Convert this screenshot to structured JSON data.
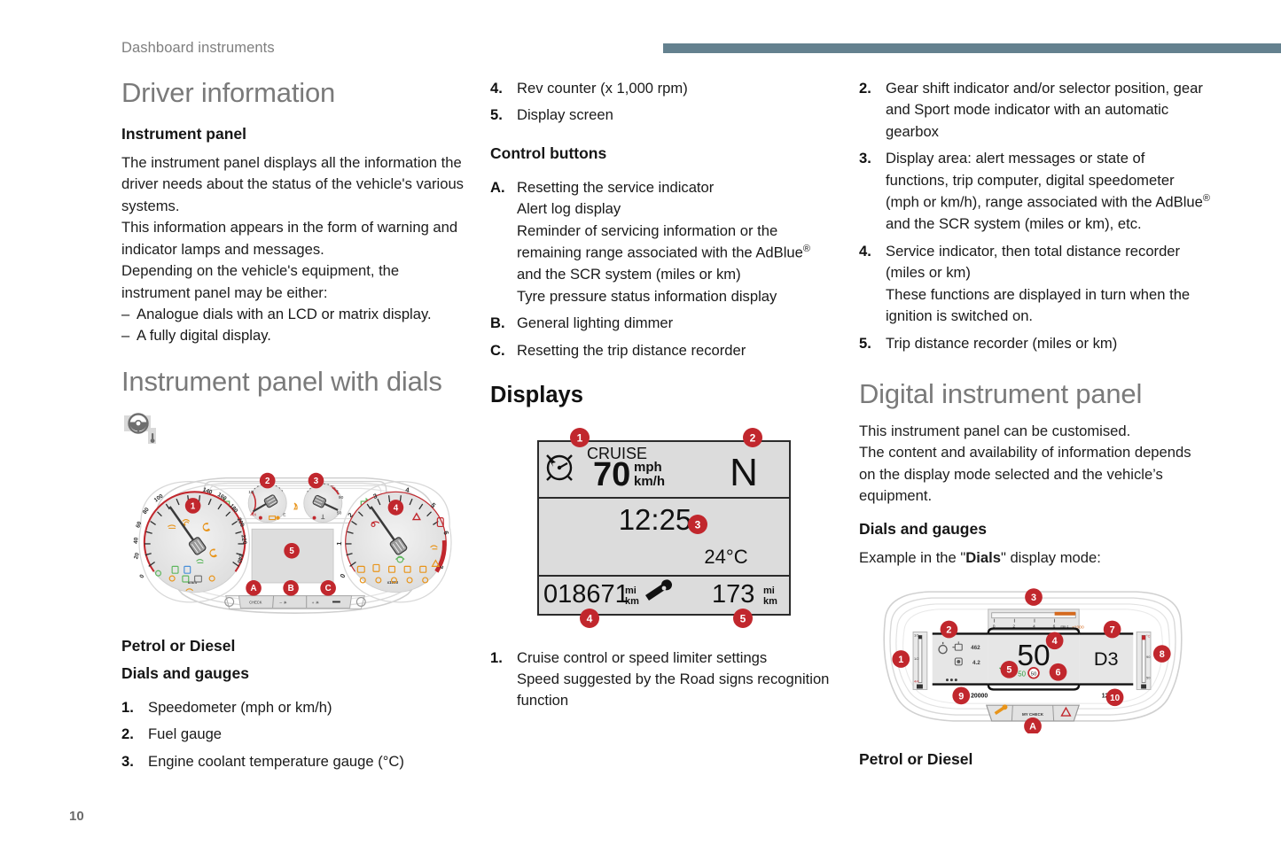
{
  "page": {
    "running_head": "Dashboard instruments",
    "folio": "10",
    "accent_rule_color": "#64818f",
    "callout_color": "#c1272d"
  },
  "col1": {
    "chapter_title": "Driver information",
    "instrument_panel_heading": "Instrument panel",
    "paragraphs": [
      "The instrument panel displays all the information the driver needs about the status of the vehicle's various systems.",
      "This information appears in the form of warning and indicator lamps and messages.",
      "Depending on the vehicle's equipment, the instrument panel may be either:"
    ],
    "bullets": [
      "Analogue dials with an LCD or matrix display.",
      "A fully digital display."
    ],
    "dials_section_title": "Instrument panel with dials",
    "lhd_icon": "steering-wheel-left-hand-drive-icon",
    "fuel_caption": "Petrol or Diesel",
    "dials_gauges_heading": "Dials and gauges",
    "items": [
      {
        "marker": "1.",
        "text": "Speedometer (mph or km/h)"
      },
      {
        "marker": "2.",
        "text": "Fuel gauge"
      },
      {
        "marker": "3.",
        "text": "Engine coolant temperature gauge (°C)"
      }
    ],
    "cluster_illustration": {
      "callouts": [
        "1",
        "2",
        "3",
        "4",
        "5",
        "A",
        "B",
        "C"
      ],
      "left_dial_ticks": [
        "0",
        "20",
        "40",
        "60",
        "80",
        "100",
        "140",
        "160",
        "180",
        "200",
        "220",
        "240"
      ],
      "left_dial_unit": "km/h",
      "right_dial_ticks": [
        "0",
        "1",
        "2",
        "3",
        "4",
        "5",
        "6",
        "7"
      ],
      "right_dial_unit": "x1000",
      "button_labels": [
        "CHECK",
        "- ☀",
        "+ ☀",
        "—"
      ]
    }
  },
  "col2": {
    "items_top": [
      {
        "marker": "4.",
        "text": "Rev counter (x 1,000 rpm)"
      },
      {
        "marker": "5.",
        "text": "Display screen"
      }
    ],
    "control_buttons_heading": "Control buttons",
    "control_items": [
      {
        "marker": "A.",
        "lines": [
          "Resetting the service indicator",
          "Alert log display",
          "Reminder of servicing information or the remaining range associated with the AdBlue® and the SCR system (miles or km)",
          "Tyre pressure status information display"
        ]
      },
      {
        "marker": "B.",
        "lines": [
          "General lighting dimmer"
        ]
      },
      {
        "marker": "C.",
        "lines": [
          "Resetting the trip distance recorder"
        ]
      }
    ],
    "displays_heading": "Displays",
    "screen": {
      "cruise_label": "CRUISE",
      "cruise_speed": "70",
      "unit_top": "mph",
      "unit_bottom": "km/h",
      "gear": "N",
      "clock": "12:25",
      "temperature": "24°C",
      "total_distance": "018671",
      "total_unit_top": "mi",
      "total_unit_bottom": "km",
      "trip_distance": "173",
      "trip_unit_top": "mi",
      "trip_unit_bottom": "km",
      "service_icon": "spanner-icon",
      "speed-limiter-icon": "speed-limiter-dial-icon",
      "callouts": [
        "1",
        "2",
        "3",
        "4",
        "5"
      ]
    },
    "items_bottom": [
      {
        "marker": "1.",
        "lines": [
          "Cruise control or speed limiter settings",
          "Speed suggested by the Road signs recognition function"
        ]
      }
    ]
  },
  "col3": {
    "items_top": [
      {
        "marker": "2.",
        "lines": [
          "Gear shift indicator and/or selector position, gear and Sport mode indicator with an automatic gearbox"
        ]
      },
      {
        "marker": "3.",
        "lines": [
          "Display area: alert messages or state of functions, trip computer, digital speedometer (mph or km/h), range associated with the AdBlue® and the SCR system (miles or km), etc."
        ]
      },
      {
        "marker": "4.",
        "lines": [
          "Service indicator, then total distance recorder (miles or km)",
          "These functions are displayed in turn when the ignition is switched on."
        ]
      },
      {
        "marker": "5.",
        "lines": [
          "Trip distance recorder (miles or km)"
        ]
      }
    ],
    "digital_panel_title": "Digital instrument panel",
    "paragraphs": [
      "This instrument panel can be customised.",
      "The content and availability of information depends on the display mode selected and the vehicle’s equipment."
    ],
    "dials_gauges_heading": "Dials and gauges",
    "example_prefix": "Example in the \"",
    "example_bold": "Dials",
    "example_suffix": "\" display mode:",
    "fuel_caption": "Petrol or Diesel",
    "digital_illustration": {
      "callouts": [
        "1",
        "2",
        "3",
        "4",
        "5",
        "6",
        "7",
        "8",
        "9",
        "10",
        "A"
      ],
      "speed": "50",
      "gear": "D3",
      "total_distance": "20000",
      "trip_distance": "123",
      "trip_value_1": "462",
      "trip_value_2": "4.2",
      "speed_limit_sign": "50",
      "rev_ticks": [
        "0",
        "2",
        "4",
        "6"
      ],
      "rev_unit": "min-1x1000",
      "fuel_top": "1/1",
      "fuel_bottom": "4/4",
      "temp_top": "°C",
      "temp_mid": "90",
      "temp_bottom": "50",
      "button_label": "MY CHECK"
    }
  }
}
